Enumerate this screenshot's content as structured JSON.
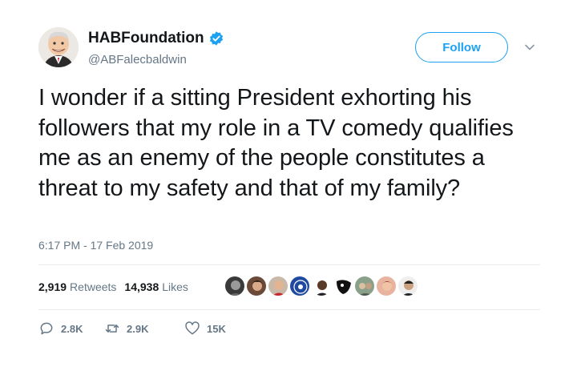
{
  "user": {
    "display_name": "HABFoundation",
    "handle": "@ABFalecbaldwin",
    "verified": true
  },
  "follow_label": "Follow",
  "tweet": {
    "text": "I wonder if a sitting President exhorting his followers that my role in a TV comedy qualifies me as an enemy of the people constitutes a threat to my safety and that of my family?",
    "timestamp": "6:17 PM - 17 Feb 2019"
  },
  "stats": {
    "retweets_count": "2,919",
    "retweets_label": "Retweets",
    "likes_count": "14,938",
    "likes_label": "Likes"
  },
  "liker_avatars": [
    "avatar-1",
    "avatar-2",
    "avatar-3",
    "avatar-4",
    "avatar-5",
    "avatar-6",
    "avatar-7",
    "avatar-8",
    "avatar-9"
  ],
  "actions": {
    "reply_count": "2.8K",
    "retweet_count": "2.9K",
    "like_count": "15K"
  },
  "colors": {
    "accent": "#1da1f2",
    "text": "#14171a",
    "secondary_text": "#657786",
    "divider": "#e6ecf0"
  }
}
